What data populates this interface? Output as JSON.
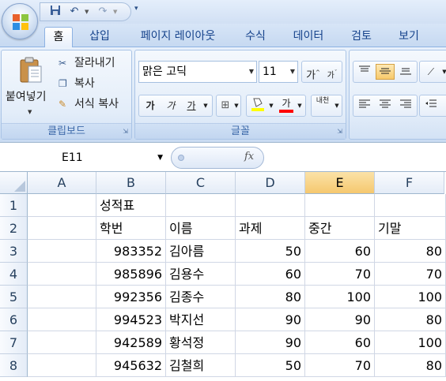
{
  "tabs": [
    "홈",
    "삽입",
    "페이지 레이아웃",
    "수식",
    "데이터",
    "검토",
    "보기"
  ],
  "clipboard": {
    "paste": "붙여넣기",
    "cut": "잘라내기",
    "copy": "복사",
    "format_painter": "서식 복사",
    "group_label": "클립보드"
  },
  "font": {
    "name": "맑은 고딕",
    "size": "11",
    "grow": "가",
    "shrink": "가",
    "bold": "가",
    "italic": "가",
    "underline": "가",
    "text_color_glyph": "가",
    "phonetic": "내천",
    "group_label": "글꼴"
  },
  "formula_bar": {
    "name_box": "E11",
    "fx": "fx"
  },
  "sheet": {
    "columns": [
      "A",
      "B",
      "C",
      "D",
      "E",
      "F"
    ],
    "selected_column": "E",
    "rows": [
      {
        "num": "1",
        "A": "",
        "B": "성적표",
        "C": "",
        "D": "",
        "E": "",
        "F": ""
      },
      {
        "num": "2",
        "A": "",
        "B": "학번",
        "C": "이름",
        "D": "과제",
        "E": "중간",
        "F": "기말"
      },
      {
        "num": "3",
        "A": "",
        "B": "983352",
        "C": "김아름",
        "D": "50",
        "E": "60",
        "F": "80"
      },
      {
        "num": "4",
        "A": "",
        "B": "985896",
        "C": "김용수",
        "D": "60",
        "E": "70",
        "F": "70"
      },
      {
        "num": "5",
        "A": "",
        "B": "992356",
        "C": "김종수",
        "D": "80",
        "E": "100",
        "F": "100"
      },
      {
        "num": "6",
        "A": "",
        "B": "994523",
        "C": "박지선",
        "D": "90",
        "E": "90",
        "F": "80"
      },
      {
        "num": "7",
        "A": "",
        "B": "942589",
        "C": "황석정",
        "D": "90",
        "E": "60",
        "F": "100"
      },
      {
        "num": "8",
        "A": "",
        "B": "945632",
        "C": "김철희",
        "D": "50",
        "E": "70",
        "F": "80"
      }
    ]
  },
  "colors": {
    "accent": "#15428b",
    "selected_header": "#f5c86e",
    "ribbon": "#dbe8f7"
  }
}
